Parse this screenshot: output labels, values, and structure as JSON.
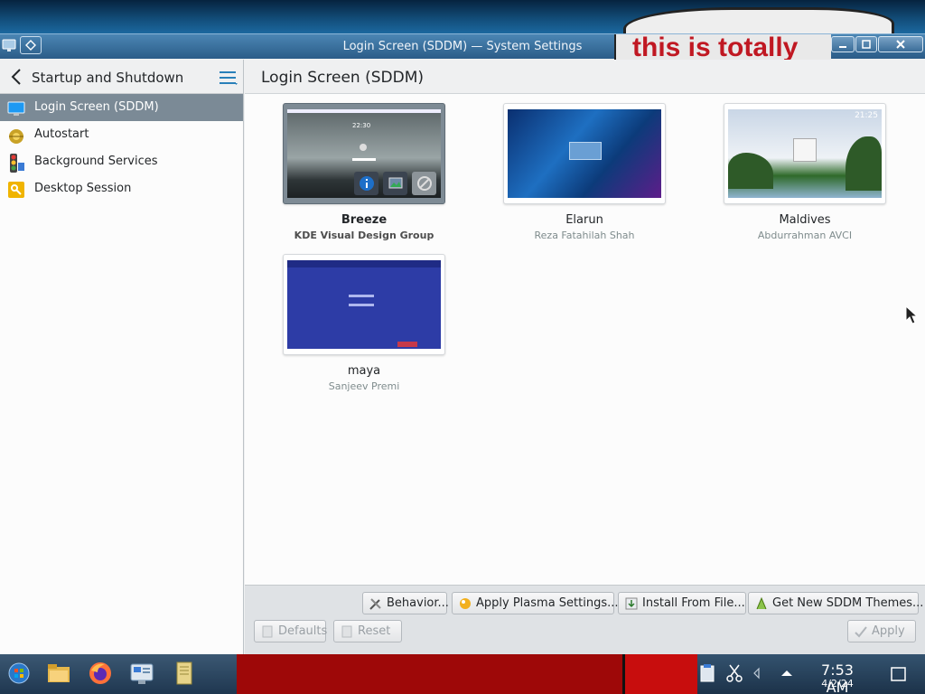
{
  "window": {
    "title": "Login Screen (SDDM) — System Settings",
    "graffiti_text": "this is totally"
  },
  "sidebar": {
    "title": "Startup and Shutdown",
    "items": [
      {
        "label": "Login Screen (SDDM)",
        "icon": "monitor-icon",
        "active": true
      },
      {
        "label": "Autostart",
        "icon": "gear-icon",
        "active": false
      },
      {
        "label": "Background Services",
        "icon": "traffic-light-icon",
        "active": false
      },
      {
        "label": "Desktop Session",
        "icon": "key-icon",
        "active": false
      }
    ]
  },
  "content": {
    "title": "Login Screen (SDDM)",
    "themes": [
      {
        "name": "Breeze",
        "author": "KDE Visual Design Group",
        "selected": true,
        "preview_time": "22:30"
      },
      {
        "name": "Elarun",
        "author": "Reza Fatahilah Shah",
        "selected": false
      },
      {
        "name": "Maldives",
        "author": "Abdurrahman AVCI",
        "selected": false,
        "preview_time": "21:25"
      },
      {
        "name": "maya",
        "author": "Sanjeev Premi",
        "selected": false
      }
    ]
  },
  "buttons": {
    "behavior": "Behavior...",
    "apply_plasma": "Apply Plasma Settings...",
    "install_file": "Install From File...",
    "get_new": "Get New SDDM Themes...",
    "defaults": "Defaults",
    "reset": "Reset",
    "apply": "Apply"
  },
  "taskbar": {
    "time": "7:53 AM",
    "date": "4/2/24"
  },
  "colors": {
    "selection": "#7b8a96",
    "titlebar": "#2b5c88",
    "accent": "#3daee9"
  }
}
